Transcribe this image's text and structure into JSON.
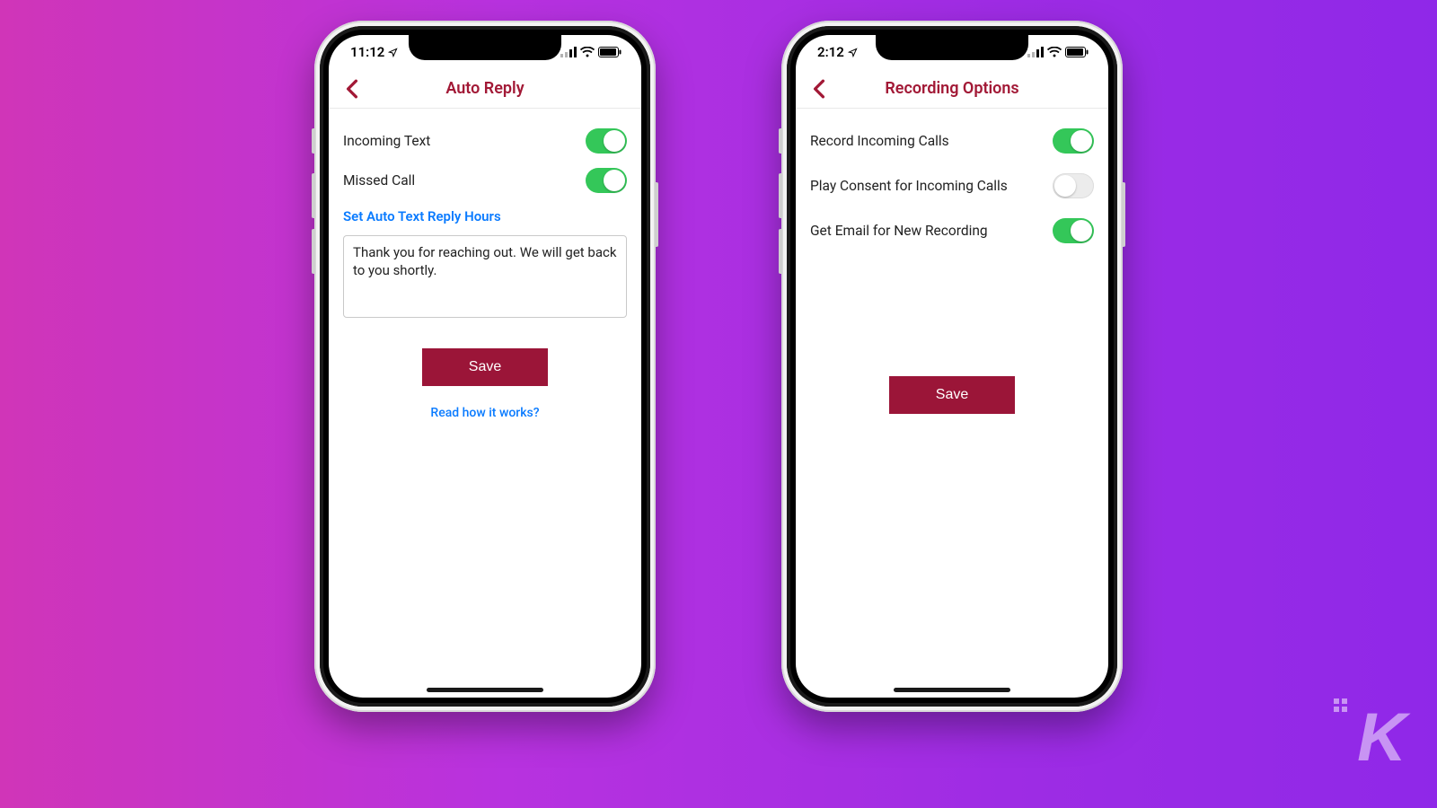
{
  "phone_left": {
    "status": {
      "time": "11:12",
      "location_glyph": "➤"
    },
    "nav": {
      "title": "Auto Reply"
    },
    "rows": [
      {
        "label": "Incoming Text",
        "on": true
      },
      {
        "label": "Missed Call",
        "on": true
      }
    ],
    "hours_link": "Set Auto Text Reply Hours",
    "message": "Thank you for reaching out. We will get back to you shortly.",
    "save": "Save",
    "how_link": "Read how it works?"
  },
  "phone_right": {
    "status": {
      "time": "2:12",
      "location_glyph": "➤"
    },
    "nav": {
      "title": "Recording Options"
    },
    "rows": [
      {
        "label": "Record Incoming Calls",
        "on": true
      },
      {
        "label": "Play Consent for Incoming Calls",
        "on": false
      },
      {
        "label": "Get Email for New Recording",
        "on": true
      }
    ],
    "save": "Save"
  },
  "watermark": "K"
}
